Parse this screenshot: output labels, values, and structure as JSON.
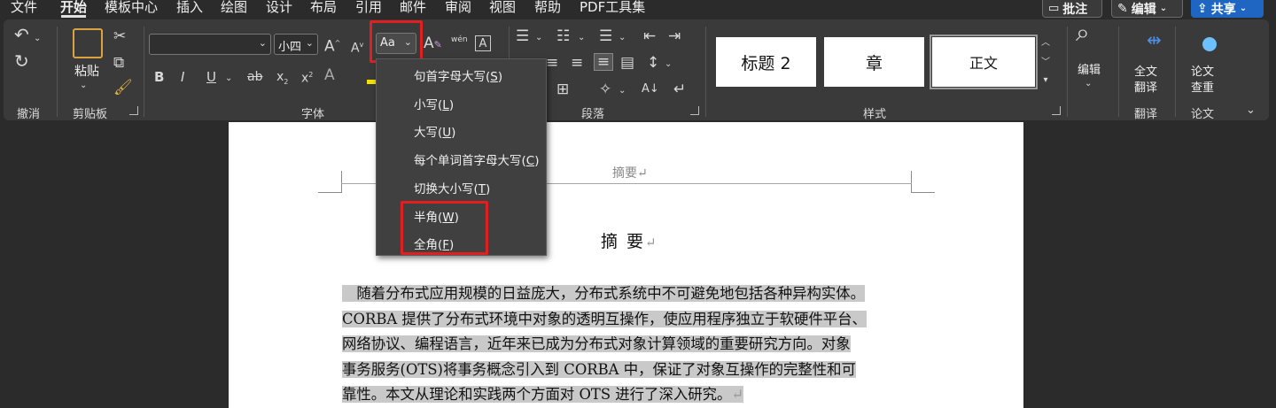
{
  "menu": {
    "items": [
      "文件",
      "开始",
      "模板中心",
      "插入",
      "绘图",
      "设计",
      "布局",
      "引用",
      "邮件",
      "审阅",
      "视图",
      "帮助",
      "PDF工具集"
    ],
    "comment_button": "批注",
    "edit_button": "编辑",
    "share_button": "共享"
  },
  "ribbon": {
    "undo_group": "撤消",
    "clipboard": {
      "paste_label": "粘贴",
      "group": "剪贴板"
    },
    "font": {
      "name_value": "",
      "size_value": "小四",
      "case_button": "Aa",
      "phonetic_label": "wén",
      "group": "字体"
    },
    "paragraph": {
      "group": "段落"
    },
    "styles": {
      "items": [
        "标题 2",
        "章",
        "正文"
      ],
      "group": "样式"
    },
    "editing": {
      "label": "编辑"
    },
    "translate": {
      "label_line1": "全文",
      "label_line2": "翻译",
      "group": "翻译"
    },
    "paper": {
      "label_line1": "论文",
      "label_line2": "查重",
      "group": "论文"
    }
  },
  "case_menu": {
    "items": [
      {
        "text": "句首字母大写(",
        "key": "S",
        "end": ")"
      },
      {
        "text": "小写(",
        "key": "L",
        "end": ")"
      },
      {
        "text": "大写(",
        "key": "U",
        "end": ")"
      },
      {
        "text": "每个单词首字母大写(",
        "key": "C",
        "end": ")"
      },
      {
        "text": "切换大小写(",
        "key": "T",
        "end": ")"
      },
      {
        "text": "半角(",
        "key": "W",
        "end": ")"
      },
      {
        "text": "全角(",
        "key": "F",
        "end": ")"
      }
    ]
  },
  "document": {
    "header": "摘要↵",
    "title": "摘 要",
    "title_mark": "↵",
    "paragraph_lines": [
      "　随着分布式应用规模的日益庞大，分布式系统中不可避免地包括各种异构实体。",
      "CORBA 提供了分布式环境中对象的透明互操作，使应用程序独立于软硬件平台、",
      "网络协议、编程语言，近年来已成为分布式对象计算领域的重要研究方向。对象",
      "事务服务(OTS)将事务概念引入到 CORBA 中，保证了对象互操作的完整性和可",
      "靠性。本文从理论和实践两个方面对 OTS 进行了深入研究。"
    ],
    "paragraph_mark": "↵"
  }
}
